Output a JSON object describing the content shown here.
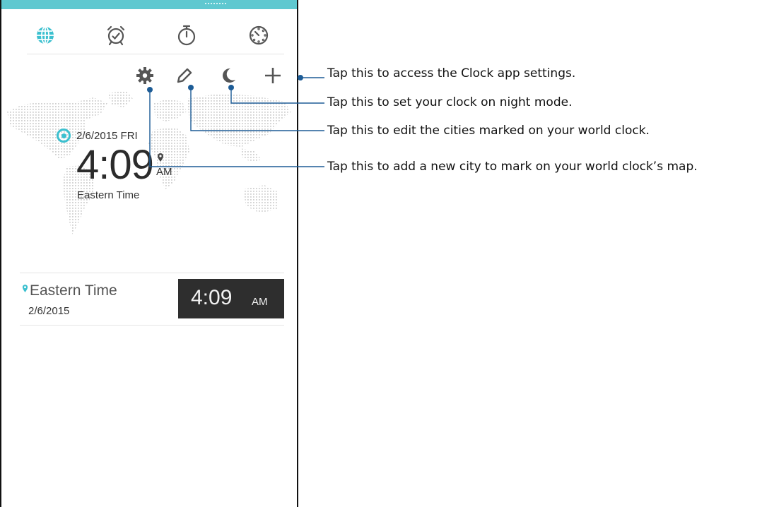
{
  "tabs": [
    {
      "name": "world-clock",
      "icon": "globe-icon",
      "active": true
    },
    {
      "name": "alarm",
      "icon": "alarm-clock-icon",
      "active": false
    },
    {
      "name": "stopwatch",
      "icon": "stopwatch-icon",
      "active": false
    },
    {
      "name": "timer",
      "icon": "timer-icon",
      "active": false
    }
  ],
  "actions": [
    {
      "name": "settings",
      "icon": "gear-icon"
    },
    {
      "name": "edit",
      "icon": "pencil-icon"
    },
    {
      "name": "night-mode",
      "icon": "moon-icon"
    },
    {
      "name": "add-city",
      "icon": "plus-icon"
    }
  ],
  "world_clock": {
    "date": "2/6/2015 FRI",
    "time": "4:09",
    "ampm": "AM",
    "zone": "Eastern Time"
  },
  "cities": [
    {
      "name": "Eastern Time",
      "date": "2/6/2015",
      "time": "4:09",
      "ampm": "AM"
    }
  ],
  "callouts": [
    "Tap this to access the Clock app settings.",
    "Tap this to set your clock on night mode.",
    "Tap this to edit the cities marked on your world clock.",
    "Tap this to add a new city to mark on your world clock’s map."
  ],
  "colors": {
    "accent": "#3cc0cf",
    "status_bar": "#5fc8d0",
    "callout_line": "#1d5c96",
    "time_box": "#2e2e2e"
  }
}
